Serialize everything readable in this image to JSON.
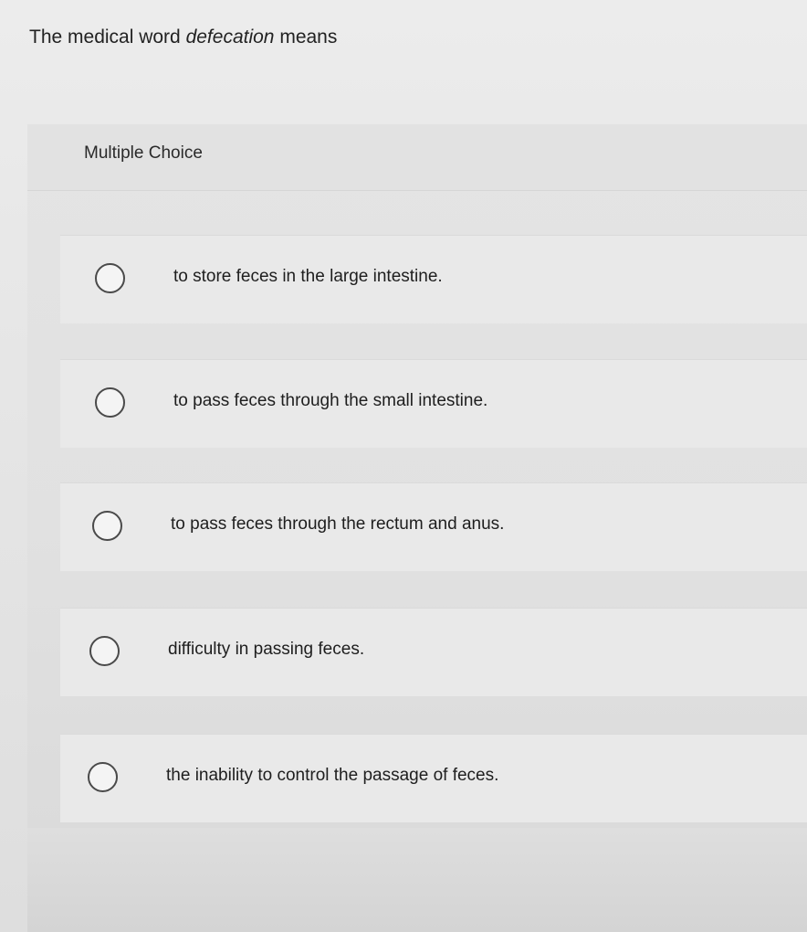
{
  "question": {
    "prefix": "The medical word ",
    "term": "defecation",
    "suffix": " means"
  },
  "section": {
    "label": "Multiple Choice"
  },
  "choices": [
    {
      "text": "to store feces in the large intestine."
    },
    {
      "text": "to pass feces through the small intestine."
    },
    {
      "text": "to pass feces through the rectum and anus."
    },
    {
      "text": "difficulty in passing feces."
    },
    {
      "text": "the inability to control the passage of feces."
    }
  ]
}
